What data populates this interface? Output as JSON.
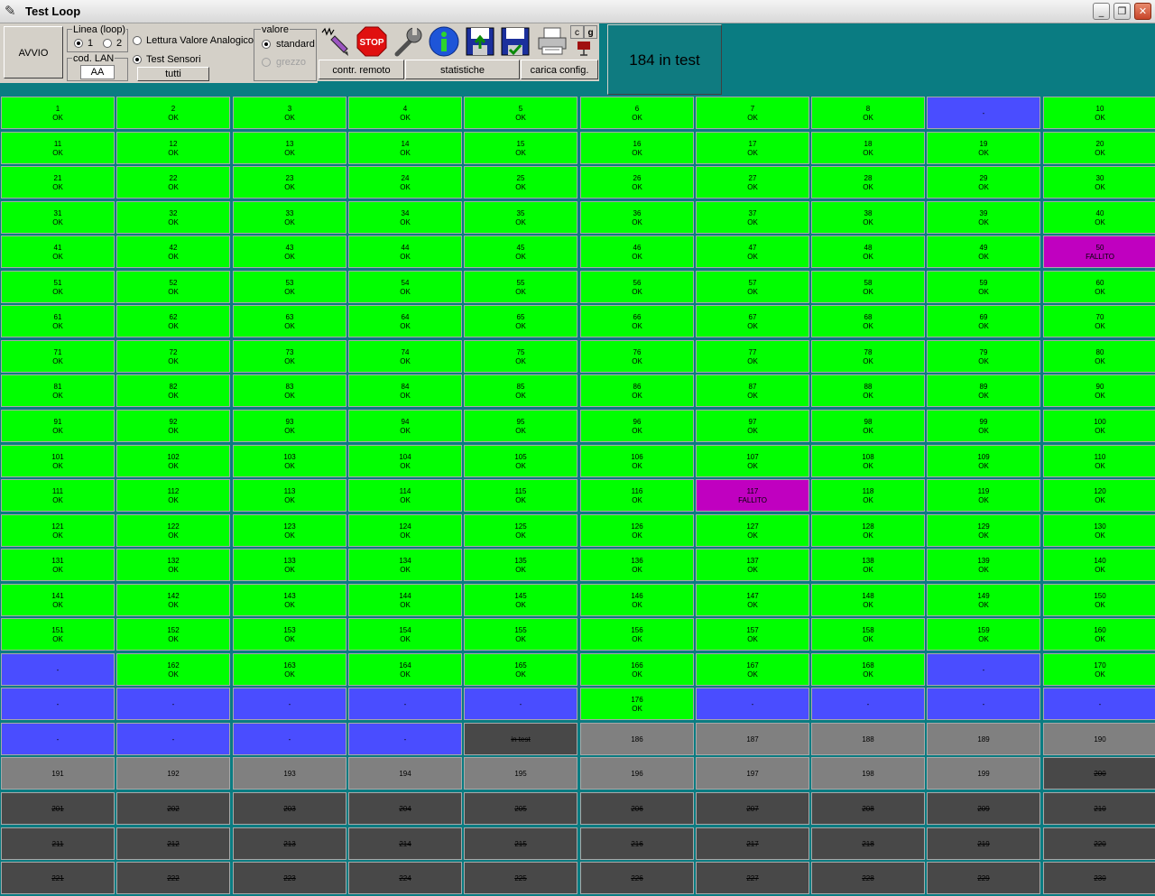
{
  "window": {
    "title": "Test Loop",
    "icon": "app-icon",
    "controls": [
      "minimize-icon",
      "restore-icon",
      "close-icon"
    ]
  },
  "toolbar": {
    "avvio_label": "AVVIO",
    "linea_group_label": "Linea (loop)",
    "linea_options": [
      "1",
      "2"
    ],
    "linea_selected": "1",
    "cod_lan_label": "cod. LAN",
    "cod_lan_value": "AA",
    "mode_options": [
      "Lettura Valore Analogico",
      "Test Sensori"
    ],
    "mode_selected": "Test Sensori",
    "tutti_label": "tutti",
    "valore_group_label": "valore",
    "valore_options": [
      "standard",
      "grezzo"
    ],
    "valore_selected": "standard",
    "icons": [
      "signal-pen-icon",
      "stop-icon",
      "wrench-icon",
      "info-icon",
      "save-upload-icon",
      "save-check-icon",
      "printer-icon",
      "cg-icon"
    ],
    "stop_text": "STOP",
    "cg_letters": [
      "c",
      "g"
    ],
    "contr_remoto_label": "contr. remoto",
    "statistiche_label": "statistiche",
    "carica_config_label": "carica config."
  },
  "counter_text": "184 in test",
  "colors": {
    "ok": "#00ff00",
    "fail": "#c000c0",
    "blue": "#4a4dff",
    "gray": "#808080",
    "dark": "#484848",
    "background": "#0a7c82"
  },
  "grid": {
    "columns": 10,
    "rows": [
      [
        [
          "ok",
          "1",
          "OK"
        ],
        [
          "ok",
          "2",
          "OK"
        ],
        [
          "ok",
          "3",
          "OK"
        ],
        [
          "ok",
          "4",
          "OK"
        ],
        [
          "ok",
          "5",
          "OK"
        ],
        [
          "ok",
          "6",
          "OK"
        ],
        [
          "ok",
          "7",
          "OK"
        ],
        [
          "ok",
          "8",
          "OK"
        ],
        [
          "blue",
          "-",
          ""
        ],
        [
          "ok",
          "10",
          "OK"
        ]
      ],
      [
        [
          "ok",
          "11",
          "OK"
        ],
        [
          "ok",
          "12",
          "OK"
        ],
        [
          "ok",
          "13",
          "OK"
        ],
        [
          "ok",
          "14",
          "OK"
        ],
        [
          "ok",
          "15",
          "OK"
        ],
        [
          "ok",
          "16",
          "OK"
        ],
        [
          "ok",
          "17",
          "OK"
        ],
        [
          "ok",
          "18",
          "OK"
        ],
        [
          "ok",
          "19",
          "OK"
        ],
        [
          "ok",
          "20",
          "OK"
        ]
      ],
      [
        [
          "ok",
          "21",
          "OK"
        ],
        [
          "ok",
          "22",
          "OK"
        ],
        [
          "ok",
          "23",
          "OK"
        ],
        [
          "ok",
          "24",
          "OK"
        ],
        [
          "ok",
          "25",
          "OK"
        ],
        [
          "ok",
          "26",
          "OK"
        ],
        [
          "ok",
          "27",
          "OK"
        ],
        [
          "ok",
          "28",
          "OK"
        ],
        [
          "ok",
          "29",
          "OK"
        ],
        [
          "ok",
          "30",
          "OK"
        ]
      ],
      [
        [
          "ok",
          "31",
          "OK"
        ],
        [
          "ok",
          "32",
          "OK"
        ],
        [
          "ok",
          "33",
          "OK"
        ],
        [
          "ok",
          "34",
          "OK"
        ],
        [
          "ok",
          "35",
          "OK"
        ],
        [
          "ok",
          "36",
          "OK"
        ],
        [
          "ok",
          "37",
          "OK"
        ],
        [
          "ok",
          "38",
          "OK"
        ],
        [
          "ok",
          "39",
          "OK"
        ],
        [
          "ok",
          "40",
          "OK"
        ]
      ],
      [
        [
          "ok",
          "41",
          "OK"
        ],
        [
          "ok",
          "42",
          "OK"
        ],
        [
          "ok",
          "43",
          "OK"
        ],
        [
          "ok",
          "44",
          "OK"
        ],
        [
          "ok",
          "45",
          "OK"
        ],
        [
          "ok",
          "46",
          "OK"
        ],
        [
          "ok",
          "47",
          "OK"
        ],
        [
          "ok",
          "48",
          "OK"
        ],
        [
          "ok",
          "49",
          "OK"
        ],
        [
          "fail",
          "50",
          "FALLITO"
        ]
      ],
      [
        [
          "ok",
          "51",
          "OK"
        ],
        [
          "ok",
          "52",
          "OK"
        ],
        [
          "ok",
          "53",
          "OK"
        ],
        [
          "ok",
          "54",
          "OK"
        ],
        [
          "ok",
          "55",
          "OK"
        ],
        [
          "ok",
          "56",
          "OK"
        ],
        [
          "ok",
          "57",
          "OK"
        ],
        [
          "ok",
          "58",
          "OK"
        ],
        [
          "ok",
          "59",
          "OK"
        ],
        [
          "ok",
          "60",
          "OK"
        ]
      ],
      [
        [
          "ok",
          "61",
          "OK"
        ],
        [
          "ok",
          "62",
          "OK"
        ],
        [
          "ok",
          "63",
          "OK"
        ],
        [
          "ok",
          "64",
          "OK"
        ],
        [
          "ok",
          "65",
          "OK"
        ],
        [
          "ok",
          "66",
          "OK"
        ],
        [
          "ok",
          "67",
          "OK"
        ],
        [
          "ok",
          "68",
          "OK"
        ],
        [
          "ok",
          "69",
          "OK"
        ],
        [
          "ok",
          "70",
          "OK"
        ]
      ],
      [
        [
          "ok",
          "71",
          "OK"
        ],
        [
          "ok",
          "72",
          "OK"
        ],
        [
          "ok",
          "73",
          "OK"
        ],
        [
          "ok",
          "74",
          "OK"
        ],
        [
          "ok",
          "75",
          "OK"
        ],
        [
          "ok",
          "76",
          "OK"
        ],
        [
          "ok",
          "77",
          "OK"
        ],
        [
          "ok",
          "78",
          "OK"
        ],
        [
          "ok",
          "79",
          "OK"
        ],
        [
          "ok",
          "80",
          "OK"
        ]
      ],
      [
        [
          "ok",
          "81",
          "OK"
        ],
        [
          "ok",
          "82",
          "OK"
        ],
        [
          "ok",
          "83",
          "OK"
        ],
        [
          "ok",
          "84",
          "OK"
        ],
        [
          "ok",
          "85",
          "OK"
        ],
        [
          "ok",
          "86",
          "OK"
        ],
        [
          "ok",
          "87",
          "OK"
        ],
        [
          "ok",
          "88",
          "OK"
        ],
        [
          "ok",
          "89",
          "OK"
        ],
        [
          "ok",
          "90",
          "OK"
        ]
      ],
      [
        [
          "ok",
          "91",
          "OK"
        ],
        [
          "ok",
          "92",
          "OK"
        ],
        [
          "ok",
          "93",
          "OK"
        ],
        [
          "ok",
          "94",
          "OK"
        ],
        [
          "ok",
          "95",
          "OK"
        ],
        [
          "ok",
          "96",
          "OK"
        ],
        [
          "ok",
          "97",
          "OK"
        ],
        [
          "ok",
          "98",
          "OK"
        ],
        [
          "ok",
          "99",
          "OK"
        ],
        [
          "ok",
          "100",
          "OK"
        ]
      ],
      [
        [
          "ok",
          "101",
          "OK"
        ],
        [
          "ok",
          "102",
          "OK"
        ],
        [
          "ok",
          "103",
          "OK"
        ],
        [
          "ok",
          "104",
          "OK"
        ],
        [
          "ok",
          "105",
          "OK"
        ],
        [
          "ok",
          "106",
          "OK"
        ],
        [
          "ok",
          "107",
          "OK"
        ],
        [
          "ok",
          "108",
          "OK"
        ],
        [
          "ok",
          "109",
          "OK"
        ],
        [
          "ok",
          "110",
          "OK"
        ]
      ],
      [
        [
          "ok",
          "111",
          "OK"
        ],
        [
          "ok",
          "112",
          "OK"
        ],
        [
          "ok",
          "113",
          "OK"
        ],
        [
          "ok",
          "114",
          "OK"
        ],
        [
          "ok",
          "115",
          "OK"
        ],
        [
          "ok",
          "116",
          "OK"
        ],
        [
          "fail",
          "117",
          "FALLITO"
        ],
        [
          "ok",
          "118",
          "OK"
        ],
        [
          "ok",
          "119",
          "OK"
        ],
        [
          "ok",
          "120",
          "OK"
        ]
      ],
      [
        [
          "ok",
          "121",
          "OK"
        ],
        [
          "ok",
          "122",
          "OK"
        ],
        [
          "ok",
          "123",
          "OK"
        ],
        [
          "ok",
          "124",
          "OK"
        ],
        [
          "ok",
          "125",
          "OK"
        ],
        [
          "ok",
          "126",
          "OK"
        ],
        [
          "ok",
          "127",
          "OK"
        ],
        [
          "ok",
          "128",
          "OK"
        ],
        [
          "ok",
          "129",
          "OK"
        ],
        [
          "ok",
          "130",
          "OK"
        ]
      ],
      [
        [
          "ok",
          "131",
          "OK"
        ],
        [
          "ok",
          "132",
          "OK"
        ],
        [
          "ok",
          "133",
          "OK"
        ],
        [
          "ok",
          "134",
          "OK"
        ],
        [
          "ok",
          "135",
          "OK"
        ],
        [
          "ok",
          "136",
          "OK"
        ],
        [
          "ok",
          "137",
          "OK"
        ],
        [
          "ok",
          "138",
          "OK"
        ],
        [
          "ok",
          "139",
          "OK"
        ],
        [
          "ok",
          "140",
          "OK"
        ]
      ],
      [
        [
          "ok",
          "141",
          "OK"
        ],
        [
          "ok",
          "142",
          "OK"
        ],
        [
          "ok",
          "143",
          "OK"
        ],
        [
          "ok",
          "144",
          "OK"
        ],
        [
          "ok",
          "145",
          "OK"
        ],
        [
          "ok",
          "146",
          "OK"
        ],
        [
          "ok",
          "147",
          "OK"
        ],
        [
          "ok",
          "148",
          "OK"
        ],
        [
          "ok",
          "149",
          "OK"
        ],
        [
          "ok",
          "150",
          "OK"
        ]
      ],
      [
        [
          "ok",
          "151",
          "OK"
        ],
        [
          "ok",
          "152",
          "OK"
        ],
        [
          "ok",
          "153",
          "OK"
        ],
        [
          "ok",
          "154",
          "OK"
        ],
        [
          "ok",
          "155",
          "OK"
        ],
        [
          "ok",
          "156",
          "OK"
        ],
        [
          "ok",
          "157",
          "OK"
        ],
        [
          "ok",
          "158",
          "OK"
        ],
        [
          "ok",
          "159",
          "OK"
        ],
        [
          "ok",
          "160",
          "OK"
        ]
      ],
      [
        [
          "blue",
          "-",
          ""
        ],
        [
          "ok",
          "162",
          "OK"
        ],
        [
          "ok",
          "163",
          "OK"
        ],
        [
          "ok",
          "164",
          "OK"
        ],
        [
          "ok",
          "165",
          "OK"
        ],
        [
          "ok",
          "166",
          "OK"
        ],
        [
          "ok",
          "167",
          "OK"
        ],
        [
          "ok",
          "168",
          "OK"
        ],
        [
          "blue",
          "-",
          ""
        ],
        [
          "ok",
          "170",
          "OK"
        ]
      ],
      [
        [
          "blue",
          "-",
          ""
        ],
        [
          "blue",
          "-",
          ""
        ],
        [
          "blue",
          "-",
          ""
        ],
        [
          "blue",
          "-",
          ""
        ],
        [
          "blue",
          "-",
          ""
        ],
        [
          "ok",
          "176",
          "OK"
        ],
        [
          "blue",
          "-",
          ""
        ],
        [
          "blue",
          "-",
          ""
        ],
        [
          "blue",
          "-",
          ""
        ],
        [
          "blue",
          "-",
          ""
        ]
      ],
      [
        [
          "blue",
          "-",
          ""
        ],
        [
          "blue",
          "-",
          ""
        ],
        [
          "blue",
          "-",
          ""
        ],
        [
          "blue",
          "-",
          ""
        ],
        [
          "dark",
          "in test",
          ""
        ],
        [
          "gray",
          "186",
          ""
        ],
        [
          "gray",
          "187",
          ""
        ],
        [
          "gray",
          "188",
          ""
        ],
        [
          "gray",
          "189",
          ""
        ],
        [
          "gray",
          "190",
          ""
        ]
      ],
      [
        [
          "gray",
          "191",
          ""
        ],
        [
          "gray",
          "192",
          ""
        ],
        [
          "gray",
          "193",
          ""
        ],
        [
          "gray",
          "194",
          ""
        ],
        [
          "gray",
          "195",
          ""
        ],
        [
          "gray",
          "196",
          ""
        ],
        [
          "gray",
          "197",
          ""
        ],
        [
          "gray",
          "198",
          ""
        ],
        [
          "gray",
          "199",
          ""
        ],
        [
          "dark",
          "200",
          ""
        ]
      ],
      [
        [
          "dark",
          "201",
          ""
        ],
        [
          "dark",
          "202",
          ""
        ],
        [
          "dark",
          "203",
          ""
        ],
        [
          "dark",
          "204",
          ""
        ],
        [
          "dark",
          "205",
          ""
        ],
        [
          "dark",
          "206",
          ""
        ],
        [
          "dark",
          "207",
          ""
        ],
        [
          "dark",
          "208",
          ""
        ],
        [
          "dark",
          "209",
          ""
        ],
        [
          "dark",
          "210",
          ""
        ]
      ],
      [
        [
          "dark",
          "211",
          ""
        ],
        [
          "dark",
          "212",
          ""
        ],
        [
          "dark",
          "213",
          ""
        ],
        [
          "dark",
          "214",
          ""
        ],
        [
          "dark",
          "215",
          ""
        ],
        [
          "dark",
          "216",
          ""
        ],
        [
          "dark",
          "217",
          ""
        ],
        [
          "dark",
          "218",
          ""
        ],
        [
          "dark",
          "219",
          ""
        ],
        [
          "dark",
          "220",
          ""
        ]
      ],
      [
        [
          "dark",
          "221",
          ""
        ],
        [
          "dark",
          "222",
          ""
        ],
        [
          "dark",
          "223",
          ""
        ],
        [
          "dark",
          "224",
          ""
        ],
        [
          "dark",
          "225",
          ""
        ],
        [
          "dark",
          "226",
          ""
        ],
        [
          "dark",
          "227",
          ""
        ],
        [
          "dark",
          "228",
          ""
        ],
        [
          "dark",
          "229",
          ""
        ],
        [
          "dark",
          "230",
          ""
        ]
      ]
    ]
  }
}
